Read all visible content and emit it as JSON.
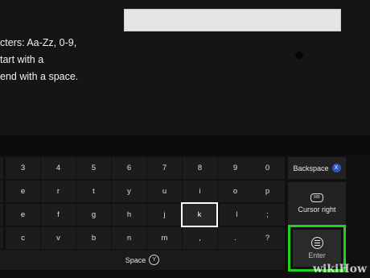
{
  "description": {
    "lines": [
      "cters: Aa-Zz, 0-9,",
      "tart with a",
      "end with a space."
    ]
  },
  "keyboard": {
    "rows": [
      [
        "3",
        "4",
        "5",
        "6",
        "7",
        "8",
        "9",
        "0"
      ],
      [
        "e",
        "r",
        "t",
        "y",
        "u",
        "i",
        "o",
        "p"
      ],
      [
        "e",
        "f",
        "g",
        "h",
        "j",
        "k",
        "l",
        ";"
      ],
      [
        "c",
        "v",
        "b",
        "n",
        "m",
        ",",
        ".",
        "?"
      ]
    ],
    "selected_key": "k",
    "space_label": "Space",
    "space_button": "Y",
    "backspace_label": "Backspace",
    "backspace_button": "X",
    "cursor_right_label": "Cursor right",
    "cursor_right_button": "RB",
    "enter_label": "Enter",
    "highlight_color": "#22d11d"
  },
  "watermark": "wikiHow"
}
